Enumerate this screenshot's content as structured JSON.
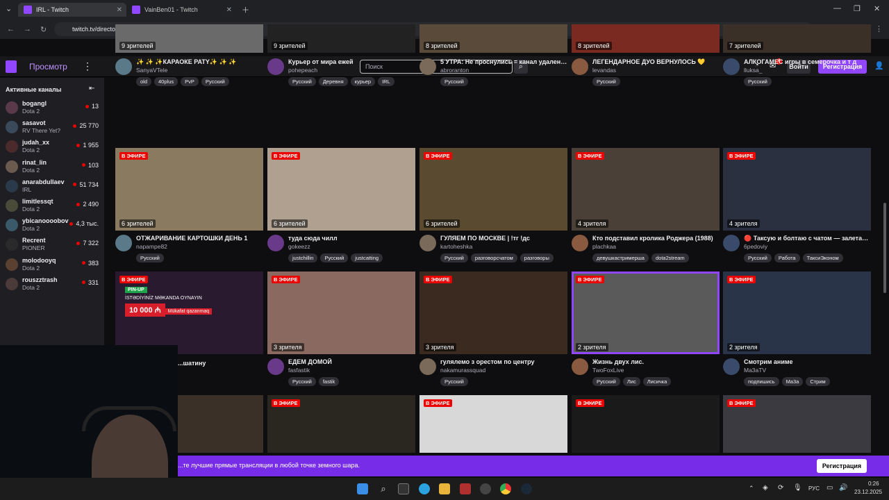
{
  "browser": {
    "tabs": [
      {
        "title": "IRL - Twitch",
        "active": true
      },
      {
        "title": "VainBen01 - Twitch",
        "active": false
      }
    ],
    "url": "twitch.tv/directory/category/irl"
  },
  "header": {
    "browse": "Просмотр",
    "search_placeholder": "Поиск",
    "login": "Войти",
    "signup": "Регистрация",
    "notif_count": "4"
  },
  "sidebar": {
    "title": "Активные каналы",
    "channels": [
      {
        "name": "bogangl",
        "game": "Dota 2",
        "viewers": "13"
      },
      {
        "name": "sasavot",
        "game": "RV There Yet?",
        "viewers": "25 770"
      },
      {
        "name": "judah_xx",
        "game": "Dota 2",
        "viewers": "1 955"
      },
      {
        "name": "rinat_lin",
        "game": "Dota 2",
        "viewers": "103"
      },
      {
        "name": "anarabdullaev",
        "game": "IRL",
        "viewers": "51 734"
      },
      {
        "name": "limitlessqt",
        "game": "Dota 2",
        "viewers": "2 490"
      },
      {
        "name": "ybicanoooobov",
        "game": "Dota 2",
        "viewers": "4,3 тыс."
      },
      {
        "name": "Recrent",
        "game": "PIONER",
        "viewers": "7 322"
      },
      {
        "name": "molodooyq",
        "game": "Dota 2",
        "viewers": "383"
      },
      {
        "name": "rouszztrash",
        "game": "Dota 2",
        "viewers": "331"
      }
    ]
  },
  "live_label": "В ЭФИРЕ",
  "rows": [
    [
      {
        "viewers": "9 зрителей",
        "title": "✨ ✨ ✨КАРАОКЕ PATY✨ ✨ ✨",
        "channel": "SanyaVTele",
        "tags": [
          "old",
          "40plus",
          "PvP",
          "Русский"
        ],
        "color": "#6a6a6a"
      },
      {
        "viewers": "9 зрителей",
        "title": "Курьер от мира ежей",
        "channel": "pohepeach",
        "tags": [
          "Русский",
          "Деревня",
          "курьер",
          "IRL"
        ],
        "color": "#222"
      },
      {
        "viewers": "8 зрителей",
        "title": "5 УТРА: Не проснулись = канал удален. ...",
        "channel": "abroranton",
        "tags": [
          "Русский"
        ],
        "color": "#5a4a3a"
      },
      {
        "viewers": "8 зрителей",
        "title": "ЛЕГЕНДАРНОЕ ДУО ВЕРНУЛОСЬ 💛",
        "channel": "levandas",
        "tags": [
          "Русский"
        ],
        "color": "#7a2a20"
      },
      {
        "viewers": "7 зрителей",
        "title": "АЛКОГАМЕС игры в семерочка и т д",
        "channel": "lluksa_",
        "tags": [
          "Русский"
        ],
        "color": "#3a3028"
      }
    ],
    [
      {
        "viewers": "6 зрителей",
        "title": "ОТЖАРИВАНИЕ КАРТОШКИ ДЕНЬ 1",
        "channel": "napampe82",
        "tags": [
          "Русский"
        ],
        "color": "#8a7a60"
      },
      {
        "viewers": "6 зрителей",
        "title": "туда сюда чилл",
        "channel": "gokeezz",
        "tags": [
          "justchillin",
          "Русский",
          "justcatting"
        ],
        "color": "#b0a090"
      },
      {
        "viewers": "6 зрителей",
        "title": "ГУЛЯЕМ ПО МОСКВЕ | !тг !дс",
        "channel": "kartoheshka",
        "tags": [
          "Русский",
          "разговорсчатом",
          "разговоры"
        ],
        "color": "#5a4a30"
      },
      {
        "viewers": "4 зрителя",
        "title": "Кто подставил кролика Роджера (1988)",
        "channel": "plachkaa",
        "tags": [
          "девушкастримерша",
          "dota2stream"
        ],
        "color": "#4a4038"
      },
      {
        "viewers": "4 зрителя",
        "title": "🔴 Таксую и болтаю с чатом — залетай...",
        "channel": "6pedoviy",
        "tags": [
          "Русский",
          "Работа",
          "ТаксиЭконом"
        ],
        "color": "#2a3040"
      }
    ],
    [
      {
        "viewers": "",
        "title": "...шатину",
        "channel": "",
        "tags": [],
        "color": "#2a1a30"
      },
      {
        "viewers": "3 зрителя",
        "title": "ЕДЕМ ДОМОЙ",
        "channel": "fasfastik",
        "tags": [
          "Русский",
          "fastik"
        ],
        "color": "#8a6a60"
      },
      {
        "viewers": "3 зрителя",
        "title": "гулялемо з орестом по центру",
        "channel": "nakamurassquad",
        "tags": [
          "Русский"
        ],
        "color": "#3a2a20"
      },
      {
        "viewers": "2 зрителя",
        "title": "Жизнь двух лис.",
        "channel": "TwoFoxLive",
        "tags": [
          "Русский",
          "Лис",
          "Лисичка"
        ],
        "color": "#5a5a5a"
      },
      {
        "viewers": "2 зрителя",
        "title": "Смотрим аниме",
        "channel": "Ma3aTV",
        "tags": [
          "подпишись",
          "Ma3a",
          "Стрим"
        ],
        "color": "#2a3448"
      }
    ],
    [
      {
        "color": "#3a3028"
      },
      {
        "color": "#2a2620"
      },
      {
        "color": "#d8d8d8"
      },
      {
        "color": "#1a1a1a"
      },
      {
        "color": "#3a3a40"
      }
    ]
  ],
  "banner": {
    "text": "...те лучшие прямые трансляции в любой точке земного шара.",
    "button": "Регистрация"
  },
  "taskbar": {
    "lang": "РУС",
    "time": "0:26",
    "date": "23.12.2025"
  },
  "ad": {
    "brand": "PIN-UP",
    "line1": "İSTƏDİYİNİZ MƏKANDA OYNAYIN",
    "amount": "10 000 ₼",
    "cta": "Mükafat qazanmaq"
  }
}
